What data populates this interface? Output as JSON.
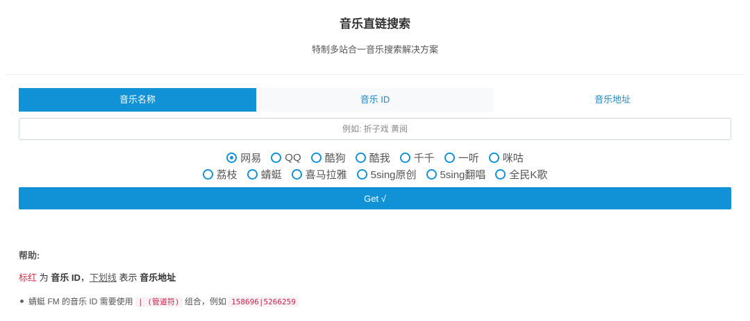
{
  "header": {
    "title": "音乐直链搜索",
    "subtitle": "特制多站合一音乐搜索解决方案"
  },
  "tabs": [
    {
      "label": "音乐名称",
      "active": true
    },
    {
      "label": "音乐 ID",
      "active": false
    },
    {
      "label": "音乐地址",
      "active": false
    }
  ],
  "search": {
    "placeholder": "例如: 折子戏 黄阅",
    "value": ""
  },
  "sources": {
    "row1": [
      "网易",
      "QQ",
      "酷狗",
      "酷我",
      "千千",
      "一听",
      "咪咕"
    ],
    "row2": [
      "荔枝",
      "蜻蜓",
      "喜马拉雅",
      "5sing原创",
      "5sing翻唱",
      "全民K歌"
    ],
    "selected": "网易"
  },
  "get_button": {
    "label": "Get √"
  },
  "help": {
    "title": "帮助:",
    "line1": {
      "red_text": "标红",
      "t1": " 为 ",
      "bold1": "音乐 ID",
      "t2": "，",
      "underline_text": "下划线",
      "t3": " 表示 ",
      "bold2": "音乐地址"
    },
    "bullet": {
      "t1": "蜻蜓 FM 的音乐 ID 需要使用 ",
      "code1": "| (管道符)",
      "t2": " 组合，例如 ",
      "code2": "158696|5266259"
    }
  },
  "colors": {
    "accent": "#1191d6",
    "highlight_red": "#d0324b"
  }
}
